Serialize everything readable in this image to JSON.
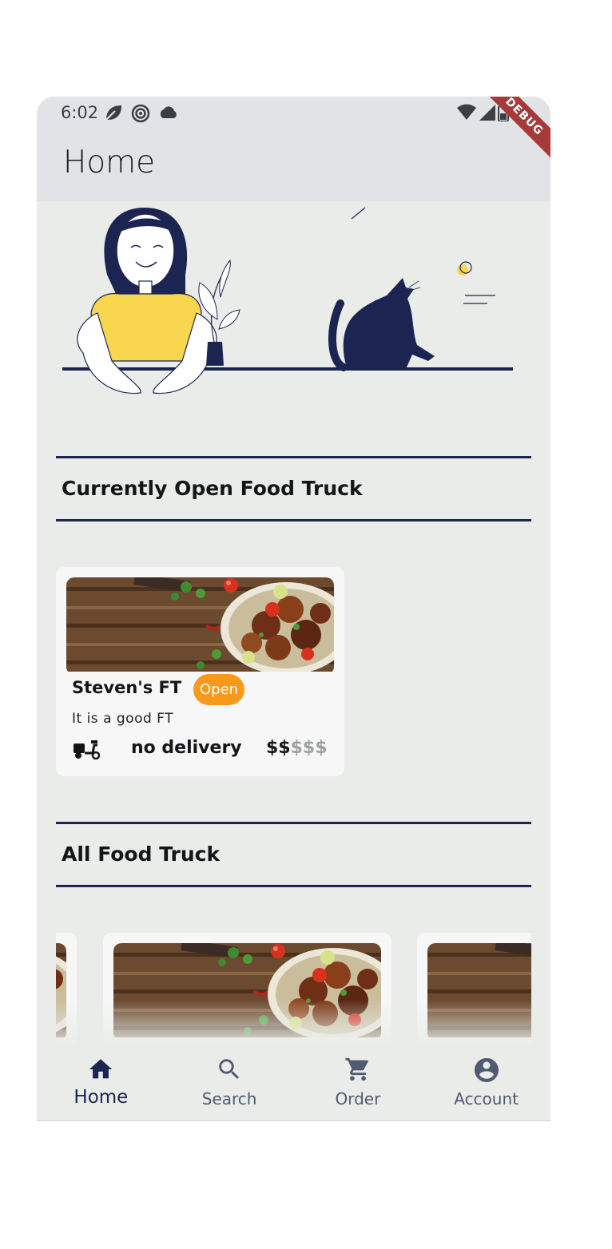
{
  "status_bar": {
    "time": "6:02",
    "left_icons": [
      "leaf-icon",
      "target-icon",
      "cloud-icon"
    ],
    "right_icons": [
      "wifi-icon",
      "signal-icon",
      "battery-icon"
    ],
    "debug_label": "DEBUG"
  },
  "app_bar": {
    "title": "Home"
  },
  "sections": {
    "open": {
      "title": "Currently Open Food Truck"
    },
    "all": {
      "title": "All Food Truck"
    }
  },
  "open_truck": {
    "name": "Steven's FT",
    "status": "Open",
    "description": "It is a good FT",
    "delivery": "no delivery",
    "price_active": "$$",
    "price_inactive": "$$$"
  },
  "bottom_nav": {
    "items": [
      {
        "label": "Home",
        "icon": "home-icon",
        "active": true
      },
      {
        "label": "Search",
        "icon": "search-icon",
        "active": false
      },
      {
        "label": "Order",
        "icon": "cart-icon",
        "active": false
      },
      {
        "label": "Account",
        "icon": "account-icon",
        "active": false
      }
    ]
  },
  "colors": {
    "accent": "#1c2551",
    "open_badge": "#f79a1b",
    "background": "#e9ece8",
    "app_bar": "#e2e3e7",
    "debug_ribbon": "#a63a3a"
  }
}
